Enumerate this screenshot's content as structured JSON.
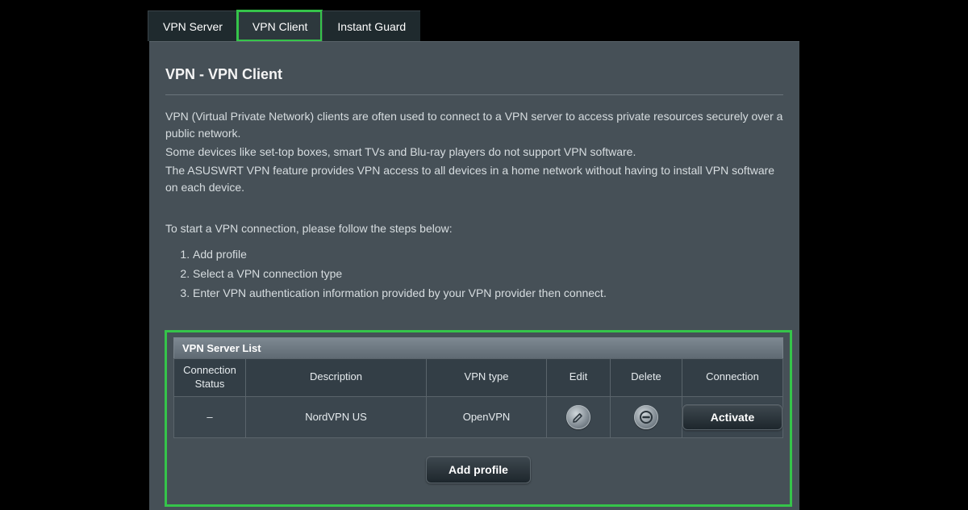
{
  "tabs": {
    "server": "VPN Server",
    "client": "VPN Client",
    "instant": "Instant Guard"
  },
  "panel": {
    "title": "VPN - VPN Client",
    "desc1": "VPN (Virtual Private Network) clients are often used to connect to a VPN server to access private resources securely over a public network.",
    "desc2": "Some devices like set-top boxes, smart TVs and Blu-ray players do not support VPN software.",
    "desc3": "The ASUSWRT VPN feature provides VPN access to all devices in a home network without having to install VPN software on each device.",
    "steps_intro": "To start a VPN connection, please follow the steps below:",
    "step1": "Add profile",
    "step2": "Select a VPN connection type",
    "step3": "Enter VPN authentication information provided by your VPN provider then connect."
  },
  "serverList": {
    "title": "VPN Server List",
    "headers": {
      "status": "Connection Status",
      "description": "Description",
      "vpntype": "VPN type",
      "edit": "Edit",
      "delete": "Delete",
      "connection": "Connection"
    },
    "rows": [
      {
        "status": "–",
        "description": "NordVPN US",
        "vpntype": "OpenVPN",
        "connection_label": "Activate"
      }
    ],
    "add_profile_label": "Add profile"
  }
}
